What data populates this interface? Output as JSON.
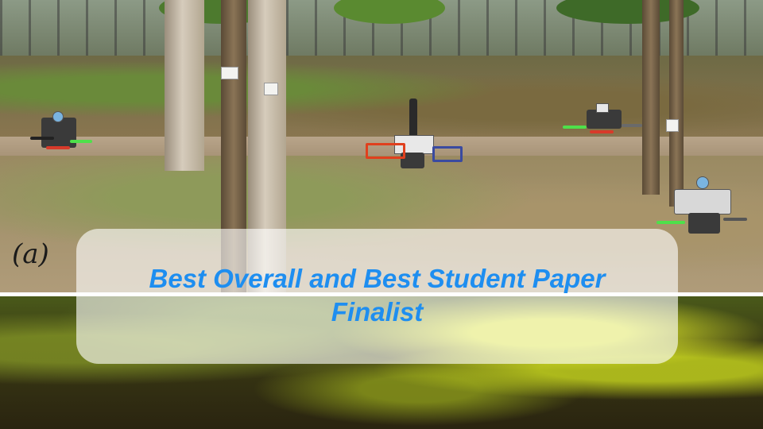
{
  "figure": {
    "panel_label": "(a)"
  },
  "banner": {
    "line1": "Best Overall and Best Student Paper",
    "line2": "Finalist"
  },
  "colors": {
    "banner_text": "#1e8ef0",
    "lower_panel_accent": "#dce628"
  }
}
